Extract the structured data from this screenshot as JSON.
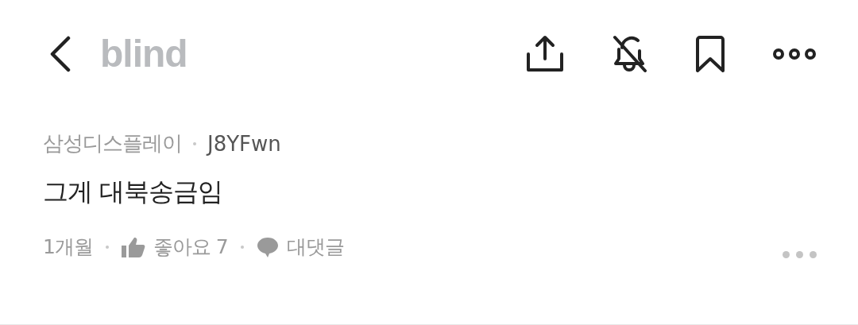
{
  "header": {
    "logo": "blind"
  },
  "comment": {
    "company": "삼성디스플레이",
    "author": "J8YFwn",
    "body": "그게 대북송금임",
    "time": "1개월",
    "like_label": "좋아요 7",
    "reply_label": "대댓글"
  }
}
